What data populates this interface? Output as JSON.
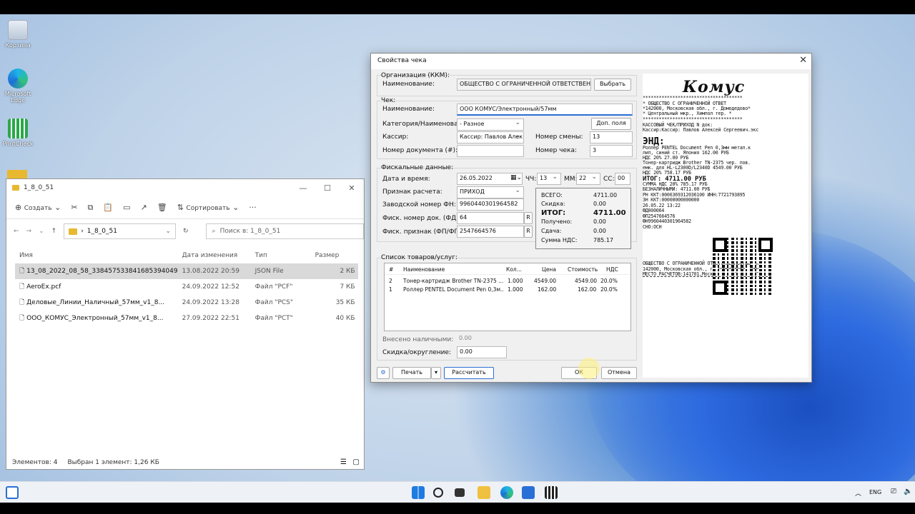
{
  "desktop": {
    "icons": [
      {
        "label": "Корзина"
      },
      {
        "label": "Microsoft Edge"
      },
      {
        "label": "PrintCheck"
      }
    ]
  },
  "explorer": {
    "title": "1_8_0_51",
    "toolbar": {
      "create": "Создать",
      "sort": "Сортировать",
      "more": "···"
    },
    "address": {
      "path": "1_8_0_51",
      "search_placeholder": "Поиск в: 1_8_0_51"
    },
    "columns": [
      "Имя",
      "Дата изменения",
      "Тип",
      "Размер"
    ],
    "files": [
      {
        "name": "13_08_2022_08_58_338457533841685394049",
        "date": "13.08.2022 20:59",
        "type": "JSON File",
        "size": "2 КБ"
      },
      {
        "name": "AeroEx.pcf",
        "date": "24.09.2022 12:52",
        "type": "Файл \"PCF\"",
        "size": "7 КБ"
      },
      {
        "name": "Деловые_Линии_Наличный_57мм_v1_8...",
        "date": "24.09.2022 13:28",
        "type": "Файл \"PCS\"",
        "size": "35 КБ"
      },
      {
        "name": "ООО_КОМУС_Электронный_57мм_v1_8...",
        "date": "27.09.2022 22:51",
        "type": "Файл \"PCT\"",
        "size": "40 КБ"
      }
    ],
    "status": {
      "count": "Элементов: 4",
      "selected": "Выбран 1 элемент: 1,26 КБ"
    }
  },
  "dialog": {
    "title": "Свойства чека",
    "org": {
      "group": "Организация (ККМ):",
      "name_label": "Наименование:",
      "name_value": "ОБЩЕСТВО С ОГРАНИЧЕННОЙ ОТВЕТСТВЕННОСТЬЮ",
      "choose": "Выбрать"
    },
    "check": {
      "group": "Чек:",
      "name_label": "Наименование:",
      "name_value": "ООО КОМУС/Электронный/57мм",
      "category_label": "Категория/Наименование:",
      "category_value": "- Разное",
      "extra": "Доп. поля",
      "cashier_label": "Кассир:",
      "cashier_value": "Кассир: Павлов Алек",
      "shift_label": "Номер смены:",
      "shift_value": "13",
      "docnum_label": "Номер документа (#):",
      "checknum_label": "Номер чека:",
      "checknum_value": "3"
    },
    "fiscal": {
      "group": "Фискальные данные:",
      "date_label": "Дата и время:",
      "date_value": "26.05.2022",
      "hh_label": "ЧЧ:",
      "hh": "13",
      "mm_label": "ММ:",
      "mm": "22",
      "ss_label": "СС:",
      "ss": "00",
      "calc_label": "Признак расчета:",
      "calc_value": "ПРИХОД",
      "fn_label": "Заводской номер ФН:",
      "fn_value": "9960440301964582",
      "fd_label": "Фиск. номер док. (ФД):",
      "fd_value": "64",
      "fp_label": "Фиск. признак (ФП/ФПД):",
      "fp_value": "2547664576",
      "r": "R"
    },
    "totals": {
      "total_label": "ВСЕГО:",
      "total": "4711.00",
      "discount_label": "Скидка:",
      "discount": "0.00",
      "itog_label": "ИТОГ:",
      "itog": "4711.00",
      "received_label": "Получено:",
      "received": "0.00",
      "change_label": "Сдача:",
      "change": "0.00",
      "vat_label": "Сумма НДС:",
      "vat": "785.17"
    },
    "goods": {
      "group": "Список товаров/услуг:",
      "columns": [
        "#",
        "Наименование",
        "Кол...",
        "Цена",
        "Стоимость",
        "НДС"
      ],
      "rows": [
        {
          "n": "2",
          "name": "Тонер-картридж Brother TN-2375 ...",
          "qty": "1.000",
          "price": "4549.00",
          "cost": "4549.00",
          "vat": "20.0%"
        },
        {
          "n": "1",
          "name": "Роллер PENTEL Document Pen 0,3м...",
          "qty": "1.000",
          "price": "162.00",
          "cost": "162.00",
          "vat": "20.0%"
        }
      ]
    },
    "cash_label": "Внесено наличными:",
    "cash_value": "0.00",
    "round_label": "Скидка/округление:",
    "round_value": "0.00",
    "buttons": {
      "print": "Печать",
      "calc": "Рассчитать",
      "ok": "ОК",
      "cancel": "Отмена"
    },
    "receipt": {
      "logo": "Комус",
      "lines": [
        "*************************************",
        "*            ОБЩЕСТВО С ОГРАНИЧЕННОЙ ОТВЕТ",
        "*142000, Московская обл., г. Домодедово*",
        "*   Центральный мкр., Химпол тер.     *",
        "*************************************",
        "КАССОВЫЙ ЧЕК/ПРИХОД              N док:",
        "Кассир:Кассир: Павлов Алексей Сергеевич.экс",
        "ЭНД:",
        "Роллер PENTEL Document Pen 0,3мм метал.к",
        "лип, синий ст. Япония 162.00 РУБ",
        "НДС 20%                        27.00 РУБ",
        "Тонер-картридж Brother TN-2375 чер. пов.",
        " емк. для HL-L2300D/L2340D    4549.00 РУБ",
        "НДС 20%                        758.17 РУБ",
        "ИТОГ:            4711.00 РУБ",
        "СУММА НДС 20%                  785.17 РУБ",
        "БЕЗНАЛИЧНЫМИ:                  4711.00 РУБ",
        "РН ККТ:0006369312036100     ИНН:7721793895",
        "ЗН ККТ:00000000000000",
        "26.05.22 13:22",
        "ФД000064",
        "ФП2547664576",
        "ФН9960440301964582",
        "СНО:ОСН",
        "ОБЩЕСТВО С ОГРАНИЧЕННОЙ ОТВЕТСТВЕННОСТЬЮ \"К",
        "142000, Московская обл., г. Домодедово, Цен",
        "МЕСТО РАСЧЕТОВ:141701,Московская обл., г. Ж"
      ]
    }
  },
  "taskbar": {
    "lang": "ENG"
  }
}
